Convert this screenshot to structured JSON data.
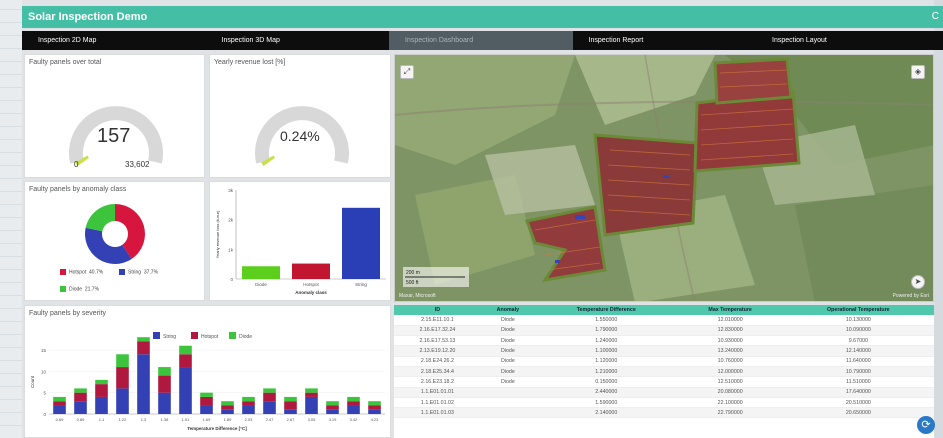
{
  "app": {
    "title": "Solar Inspection Demo",
    "title_right": "C"
  },
  "tabs": [
    {
      "label": "Inspection 2D Map"
    },
    {
      "label": "Inspection 3D Map"
    },
    {
      "label": "Inspection Dashboard"
    },
    {
      "label": "Inspection Report"
    },
    {
      "label": "Inspection Layout"
    }
  ],
  "active_tab": "Inspection Dashboard",
  "gauge_faulty": {
    "title": "Faulty panels over total",
    "value": "157",
    "min": "0",
    "max": "33,602",
    "fraction": 0.0047
  },
  "gauge_revenue": {
    "title": "Yearly revenue lost [%]",
    "value": "0.24%",
    "fraction": 0.0024
  },
  "pie_panel": {
    "title": "Faulty panels by anomaly class",
    "legend": [
      {
        "label": "Hotspot",
        "pct": "40.7%",
        "color": "#d6163e"
      },
      {
        "label": "String",
        "pct": "37.7%",
        "color": "#3341b5"
      },
      {
        "label": "Diode",
        "pct": "21.7%",
        "color": "#3cc43c"
      }
    ]
  },
  "bar_panel": {
    "ylabel": "Yearly revenue loss (k-eur)",
    "xlabel": "Anomaly class",
    "yticks": [
      "3k",
      "2k",
      "1k",
      "0"
    ]
  },
  "severity_panel": {
    "title": "Faulty panels by severity",
    "legend": [
      {
        "label": "String",
        "color": "#3341b5"
      },
      {
        "label": "Hotspot",
        "color": "#b01840"
      },
      {
        "label": "Diode",
        "color": "#3cc43c"
      }
    ],
    "ylabel": "Count",
    "xlabel": "Temperature Difference [°C]",
    "yticks": [
      "15",
      "10",
      "5",
      "0"
    ],
    "xticks": [
      "0.69",
      "0.89",
      "1.1",
      "1.22",
      "1.3",
      "1.38",
      "1.51",
      "1.69",
      "1.89",
      "2.03",
      "2.47",
      "2.67",
      "3.05",
      "3.19",
      "3.42",
      "4.23"
    ]
  },
  "chart_data": [
    {
      "type": "pie",
      "title": "Faulty panels by anomaly class",
      "labels": [
        "Hotspot",
        "String",
        "Diode"
      ],
      "values": [
        40.7,
        37.7,
        21.7
      ],
      "colors": [
        "#d6163e",
        "#3341b5",
        "#3cc43c"
      ],
      "donut": true
    },
    {
      "type": "bar",
      "categories": [
        "Diode",
        "Hotspot",
        "String"
      ],
      "values": [
        430,
        520,
        2400
      ],
      "colors": [
        "#5ccf1d",
        "#c21530",
        "#2a3fb5"
      ],
      "ylabel": "Yearly revenue loss (k-eur)",
      "xlabel": "Anomaly class",
      "ylim": [
        0,
        3000
      ]
    },
    {
      "type": "bar",
      "title": "Faulty panels by severity",
      "x": [
        "0.69",
        "0.89",
        "1.1",
        "1.22",
        "1.3",
        "1.38",
        "1.51",
        "1.69",
        "1.89",
        "2.03",
        "2.47",
        "2.67",
        "3.05",
        "3.19",
        "3.42",
        "4.23"
      ],
      "series": [
        {
          "name": "String",
          "values": [
            2,
            3,
            4,
            6,
            14,
            5,
            11,
            2,
            1,
            2,
            3,
            1,
            4,
            1,
            2,
            1
          ]
        },
        {
          "name": "Hotspot",
          "values": [
            1,
            2,
            3,
            5,
            3,
            4,
            3,
            2,
            1,
            1,
            2,
            2,
            1,
            1,
            1,
            1
          ]
        },
        {
          "name": "Diode",
          "values": [
            1,
            1,
            1,
            3,
            1,
            2,
            2,
            1,
            1,
            1,
            1,
            1,
            1,
            1,
            1,
            1
          ]
        }
      ],
      "ylabel": "Count",
      "xlabel": "Temperature Difference [°C]",
      "ylim": [
        0,
        15
      ]
    }
  ],
  "map": {
    "scale_top": "200 m",
    "scale_bottom": "500 ft",
    "credit_left": "Maxar, Microsoft",
    "credit_right": "Powered by Esri"
  },
  "table": {
    "headers": [
      "ID",
      "Anomaly",
      "Temperature Difference",
      "Max Temperature",
      "Operational Temperature"
    ],
    "rows": [
      [
        "2.15.E11.10.1",
        "Diode",
        "1.550000",
        "12.010000",
        "10.130000"
      ],
      [
        "2.16.E17.32.24",
        "Diode",
        "1.790000",
        "12.830000",
        "10.090000"
      ],
      [
        "2.16.E17.53.13",
        "Diode",
        "1.240000",
        "10.930000",
        "9.67000"
      ],
      [
        "2.13.E19.12.20",
        "Diode",
        "1.100000",
        "13.240000",
        "12.140000"
      ],
      [
        "2.18.E24.26.2",
        "Diode",
        "1.120000",
        "10.760000",
        "11.640000"
      ],
      [
        "2.18.E25.34.4",
        "Diode",
        "1.210000",
        "12.000000",
        "10.790000"
      ],
      [
        "2.16.E23.18.2",
        "Diode",
        "0.150000",
        "12.510000",
        "11.510000"
      ],
      [
        "1.1.E01.01.01",
        "",
        "2.440000",
        "20.080000",
        "17.640000"
      ],
      [
        "1.1.E01.01.02",
        "",
        "1.590000",
        "22.100000",
        "20.510000"
      ],
      [
        "1.1.E01.01.03",
        "",
        "2.140000",
        "22.790000",
        "20.650000"
      ]
    ]
  }
}
